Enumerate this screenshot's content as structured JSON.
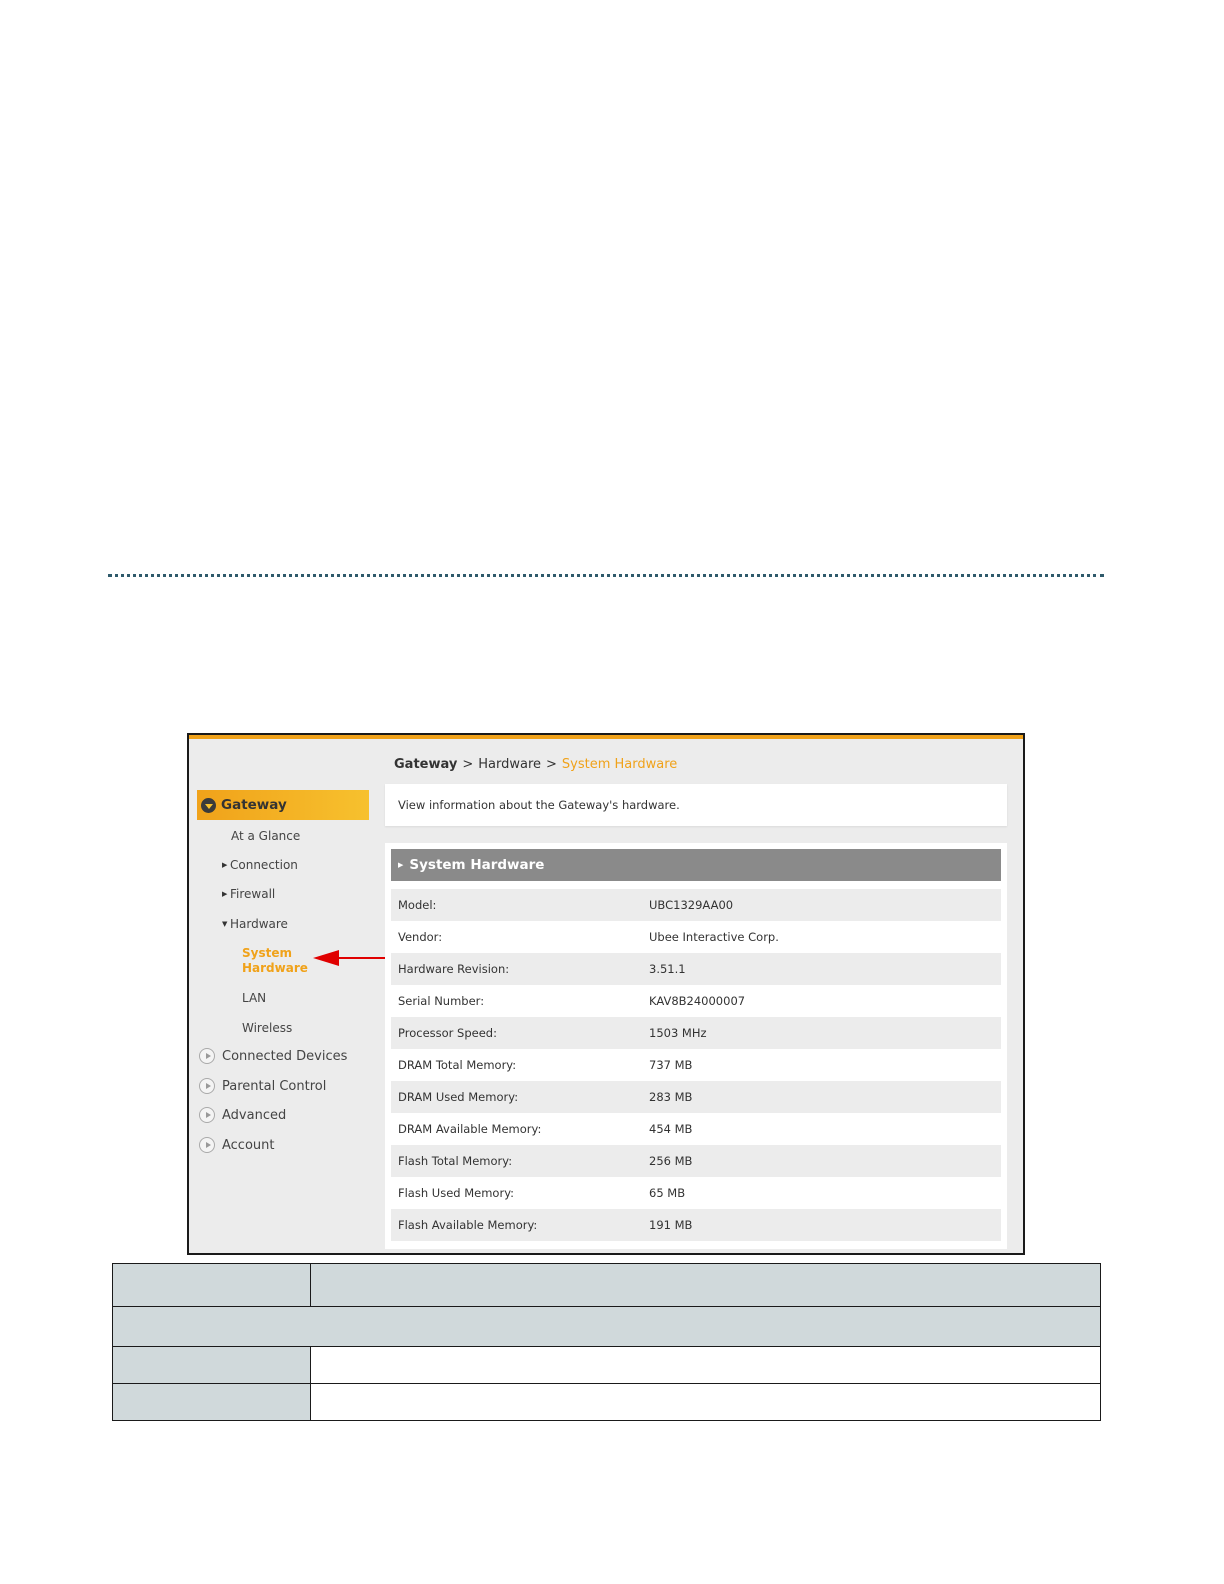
{
  "breadcrumb": {
    "root": "Gateway",
    "sep1": ">",
    "middle": "Hardware",
    "sep2": ">",
    "current": "System Hardware"
  },
  "sidebar": {
    "gateway_label": "Gateway",
    "sub_items": [
      {
        "label": "At a Glance"
      },
      {
        "label": "Connection"
      },
      {
        "label": "Firewall"
      },
      {
        "label": "Hardware"
      },
      {
        "label_line1": "System",
        "label_line2": "Hardware"
      },
      {
        "label": "LAN"
      },
      {
        "label": "Wireless"
      }
    ],
    "main_items": [
      {
        "label": "Connected Devices"
      },
      {
        "label": "Parental Control"
      },
      {
        "label": "Advanced"
      },
      {
        "label": "Account"
      }
    ]
  },
  "description": "View information about the Gateway's hardware.",
  "hardware": {
    "title": "System Hardware",
    "rows": [
      {
        "label": "Model:",
        "value": "UBC1329AA00"
      },
      {
        "label": "Vendor:",
        "value": "Ubee Interactive Corp."
      },
      {
        "label": "Hardware Revision:",
        "value": "3.51.1"
      },
      {
        "label": "Serial Number:",
        "value": "KAV8B24000007"
      },
      {
        "label": "Processor Speed:",
        "value": "1503 MHz"
      },
      {
        "label": "DRAM Total Memory:",
        "value": "737 MB"
      },
      {
        "label": "DRAM Used Memory:",
        "value": "283 MB"
      },
      {
        "label": "DRAM Available Memory:",
        "value": "454 MB"
      },
      {
        "label": "Flash Total Memory:",
        "value": "256 MB"
      },
      {
        "label": "Flash Used Memory:",
        "value": "65 MB"
      },
      {
        "label": "Flash Available Memory:",
        "value": "191 MB"
      }
    ]
  },
  "colors": {
    "accent": "#f0a21a",
    "header_gray": "#8a8a8a",
    "table_shade": "#d0d9db",
    "arrow_red": "#e00000"
  }
}
